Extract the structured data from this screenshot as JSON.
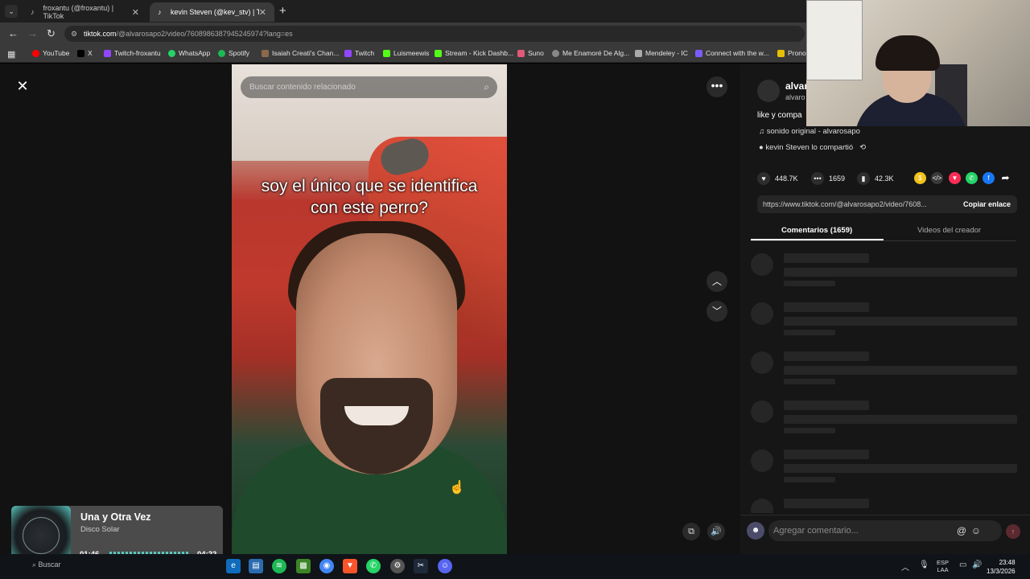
{
  "browser": {
    "tabs": [
      {
        "label": "froxantu (@froxantu) | TikTok",
        "active": false
      },
      {
        "label": "kevin Steven (@kev_stv) | TikTo",
        "active": true
      }
    ],
    "url_domain": "tiktok.com",
    "url_path": "/@alvarosapo2/video/7608986387945245974?lang=es",
    "bookmarks": [
      {
        "label": "YouTube",
        "color": "#ff0000"
      },
      {
        "label": "X",
        "color": "#000000"
      },
      {
        "label": "Twitch-froxantu",
        "color": "#9146ff"
      },
      {
        "label": "WhatsApp",
        "color": "#25d366"
      },
      {
        "label": "Spotify",
        "color": "#1db954"
      },
      {
        "label": "Isaiah Creati's Chan...",
        "color": "#8a6a4a"
      },
      {
        "label": "Twitch",
        "color": "#9146ff"
      },
      {
        "label": "Luismeewis",
        "color": "#53fc18"
      },
      {
        "label": "Stream - Kick Dashb...",
        "color": "#53fc18"
      },
      {
        "label": "Suno",
        "color": "#e05a7a"
      },
      {
        "label": "Me Enamoré De Alg...",
        "color": "#888888"
      },
      {
        "label": "Mendeley - IC",
        "color": "#aaaaaa"
      },
      {
        "label": "Connect with the w...",
        "color": "#7b5cff"
      },
      {
        "label": "Prono",
        "color": "#e5c100"
      }
    ]
  },
  "video": {
    "search_placeholder": "Buscar contenido relacionado",
    "caption_line1": "soy el único que se identifica",
    "caption_line2": "con este perro?"
  },
  "sidebar": {
    "username": "alvar",
    "handle": "alvaro",
    "description": "like y compa",
    "sound": "sonido original - alvarosapo",
    "shared_by": "kevin Steven lo compartió",
    "likes": "448.7K",
    "comments_count": "1659",
    "saves": "42.3K",
    "link": "https://www.tiktok.com/@alvarosapo2/video/7608...",
    "copy_label": "Copiar enlace",
    "tab_comments": "Comentarios (1659)",
    "tab_videos": "Videos del creador",
    "comment_placeholder": "Agregar comentario...",
    "share_icons": [
      {
        "icon": "coin-icon",
        "color": "#f2c21b"
      },
      {
        "icon": "embed-icon",
        "color": "#3a3a3a"
      },
      {
        "icon": "send-icon",
        "color": "#fe2c55"
      },
      {
        "icon": "whatsapp-icon",
        "color": "#25d366"
      },
      {
        "icon": "facebook-icon",
        "color": "#1877f2"
      },
      {
        "icon": "share-arrow-icon",
        "color": "#161616"
      }
    ]
  },
  "player": {
    "title": "Una y Otra Vez",
    "artist": "Disco Solar",
    "elapsed": "01:46",
    "duration": "04:22",
    "progress": 0.4
  },
  "taskbar": {
    "search": "Buscar",
    "lang1": "ESP",
    "lang2": "LAA",
    "time": "23:48",
    "date": "13/3/2026"
  }
}
